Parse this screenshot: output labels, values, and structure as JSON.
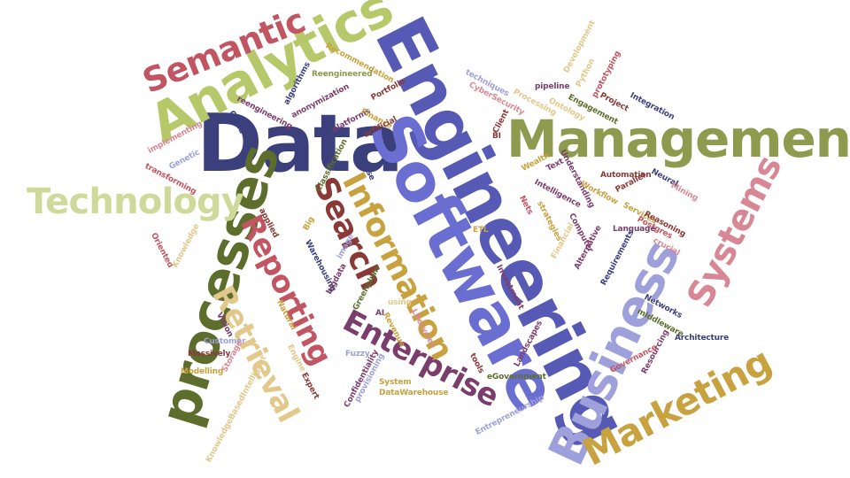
{
  "palette": {
    "navy": "#3b3f7c",
    "periwinkle": "#6a6ed0",
    "olive": "#8e9a4e",
    "lime": "#b6c86a",
    "pale_lime": "#cfd99a",
    "crimson": "#c25562",
    "rose": "#d88895",
    "maroon": "#8a3a36",
    "gold": "#c7a23e",
    "tan": "#e2c88a",
    "plum": "#7b3d6b",
    "lavender": "#9da0db",
    "dark_olive": "#5d6e2c"
  },
  "words": {
    "data": "Data",
    "engineering": "Engineering",
    "software": "Software",
    "management": "Management",
    "analytics": "Analytics",
    "semantic": "Semantic",
    "processes": "processes",
    "technology": "Technology",
    "business": "Business",
    "systems": "Systems",
    "marketing": "Marketing",
    "information": "Information",
    "search": "Search",
    "reporting": "Reporting",
    "retrieval": "Retrieval",
    "enterprise": "Enterprise",
    "recommendation": "Recommendation",
    "reengineered": "Reengineered",
    "algorithms": "algorithms",
    "reengineering": "reengineering",
    "anonymization": "anonymization",
    "cloud": "Cloud",
    "ml": "ML",
    "platforms": "platforms",
    "portfolio": "Portfolio",
    "finance": "Finance",
    "artificial": "artificial",
    "implementing": "implementing",
    "genetic": "Genetic",
    "transforming": "transforming",
    "techniques": "techniques",
    "cybersecurity": "CyberSecurity",
    "processing": "Processing",
    "ontology": "Ontology",
    "pipeline": "pipeline",
    "development": "Development",
    "python": "Python",
    "prototyping": "prototyping",
    "engagement": "Engagement",
    "project": "Project",
    "integration": "Integration",
    "client": "Client",
    "bi": "BI",
    "automation": "Automation",
    "neural": "Neural",
    "mining": "Mining",
    "wealth": "Wealth",
    "text": "Text",
    "understanding": "Understanding",
    "intelligence": "Intelligence",
    "workflow": "Workflow",
    "parallel": "Parallel",
    "use": "use",
    "nets": "Nets",
    "strategies": "strategies",
    "computer": "Computer",
    "services": "Services",
    "reasoning": "Reasoning",
    "postgres": "Postgres",
    "language": "Language",
    "crucial": "crucial",
    "applied": "applied",
    "classification": "Classification",
    "big": "Big",
    "warehousing": "Warehousing",
    "image": "image",
    "bigdata": "bigdata",
    "greenplum": "Greenplum",
    "natural": "Natural",
    "using": "using",
    "ai": "AI",
    "revenue": "Revenue",
    "lifecycles": "Lifecycles",
    "financial": "Financial",
    "alternative": "Alternative",
    "investment": "Investment",
    "requirements": "Requirements",
    "networks": "Networks",
    "middleware": "middleware",
    "architecture": "Architecture",
    "resourcing": "Resourcing",
    "governance": "Governance",
    "etl": "ETL",
    "landscapes": "Landscapes",
    "tools": "tools",
    "egovernment": "eGovernment",
    "entrepreneurship": "Entrepreneurship",
    "oriented": "Oriented",
    "knowledge": "Knowledge",
    "vision": "Vision",
    "customer": "Customer",
    "massively": "Massively",
    "storage": "Storage",
    "modelling": "Modelling",
    "engine": "Engine",
    "expert": "Expert",
    "fuzzy": "Fuzzy",
    "confidentiality": "Confidentiality",
    "provisioning": "provisioning",
    "system": "System",
    "datawarehouse": "DataWarehouse",
    "knowledgebasedintelligent": "KnowledgeBasedIntelligent"
  }
}
